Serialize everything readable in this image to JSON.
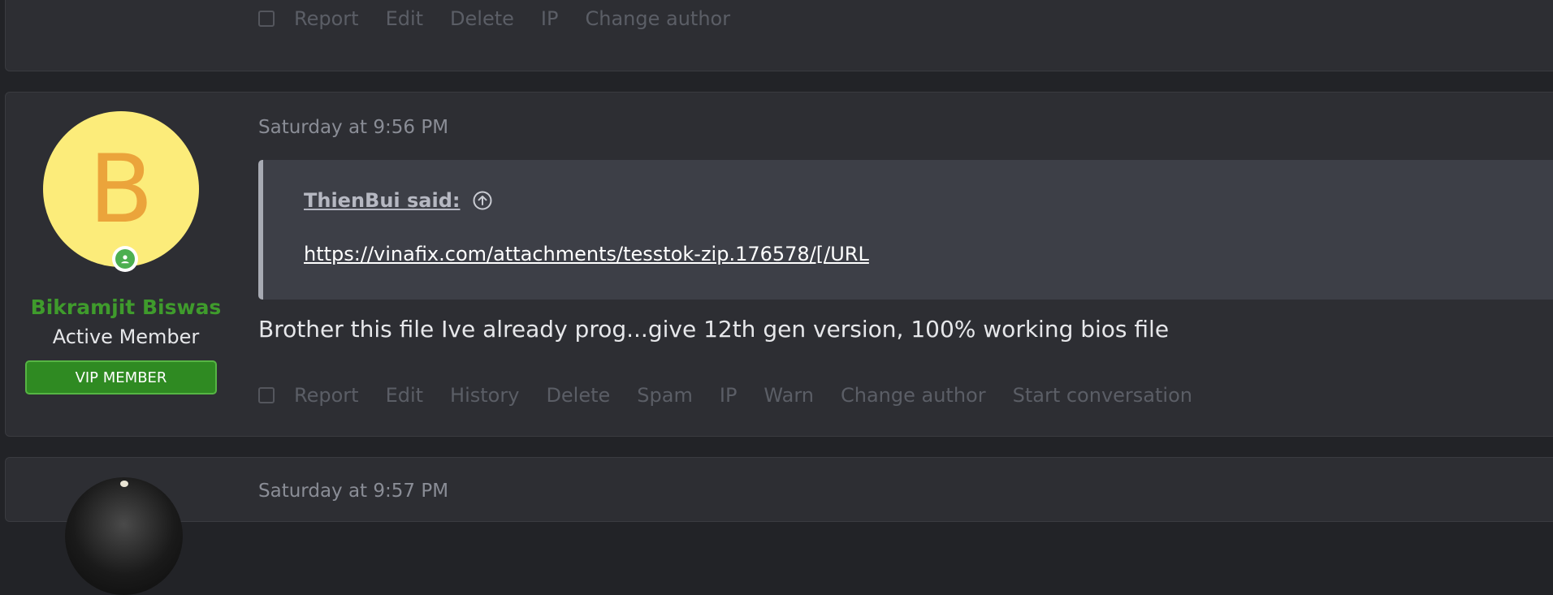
{
  "post_top": {
    "actions": [
      "Report",
      "Edit",
      "Delete",
      "IP",
      "Change author"
    ]
  },
  "post_main": {
    "avatar_letter": "B",
    "username": "Bikramjit Biswas",
    "user_title": "Active Member",
    "user_banner": "VIP MEMBER",
    "date": "Saturday at 9:56 PM",
    "quote": {
      "author": "ThienBui said:",
      "link": "https://vinafix.com/attachments/tesstok-zip.176578/[/URL"
    },
    "message": "Brother this file Ive already prog...give 12th gen version, 100% working bios file",
    "actions": [
      "Report",
      "Edit",
      "History",
      "Delete",
      "Spam",
      "IP",
      "Warn",
      "Change author",
      "Start conversation"
    ]
  },
  "post_bottom": {
    "date": "Saturday at 9:57 PM"
  },
  "colors": {
    "page_bg": "#222327",
    "post_bg": "#2d2e33",
    "quote_bg": "#3d3f47",
    "username": "#3f9b2c",
    "banner_bg": "#2f8a22",
    "avatar_bg": "#fcec7a",
    "avatar_letter": "#eba43b"
  }
}
